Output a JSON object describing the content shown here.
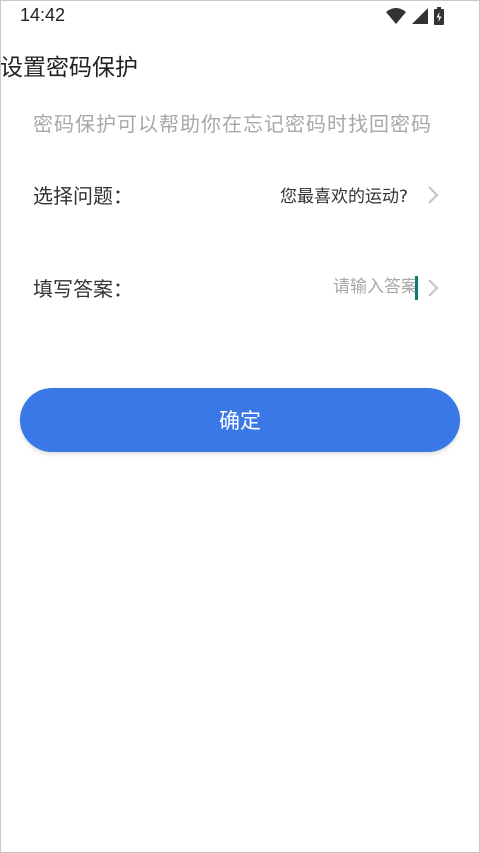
{
  "status_bar": {
    "time": "14:42",
    "icons": [
      "wifi-icon",
      "signal-icon",
      "battery-icon"
    ]
  },
  "header": {
    "title": "设置密码保护"
  },
  "hint": "密码保护可以帮助你在忘记密码时找回密码",
  "question_row": {
    "label": "选择问题：",
    "value": "您最喜欢的运动?",
    "icon": "chevron-right-icon"
  },
  "answer_row": {
    "label": "填写答案：",
    "placeholder": "请输入答案",
    "value": "",
    "icon": "chevron-right-icon"
  },
  "confirm_button": {
    "label": "确定"
  },
  "colors": {
    "accent": "#3a78e8",
    "hint_text": "#a8a8a8",
    "primary_text": "#333333",
    "caret": "#0e7c74"
  }
}
